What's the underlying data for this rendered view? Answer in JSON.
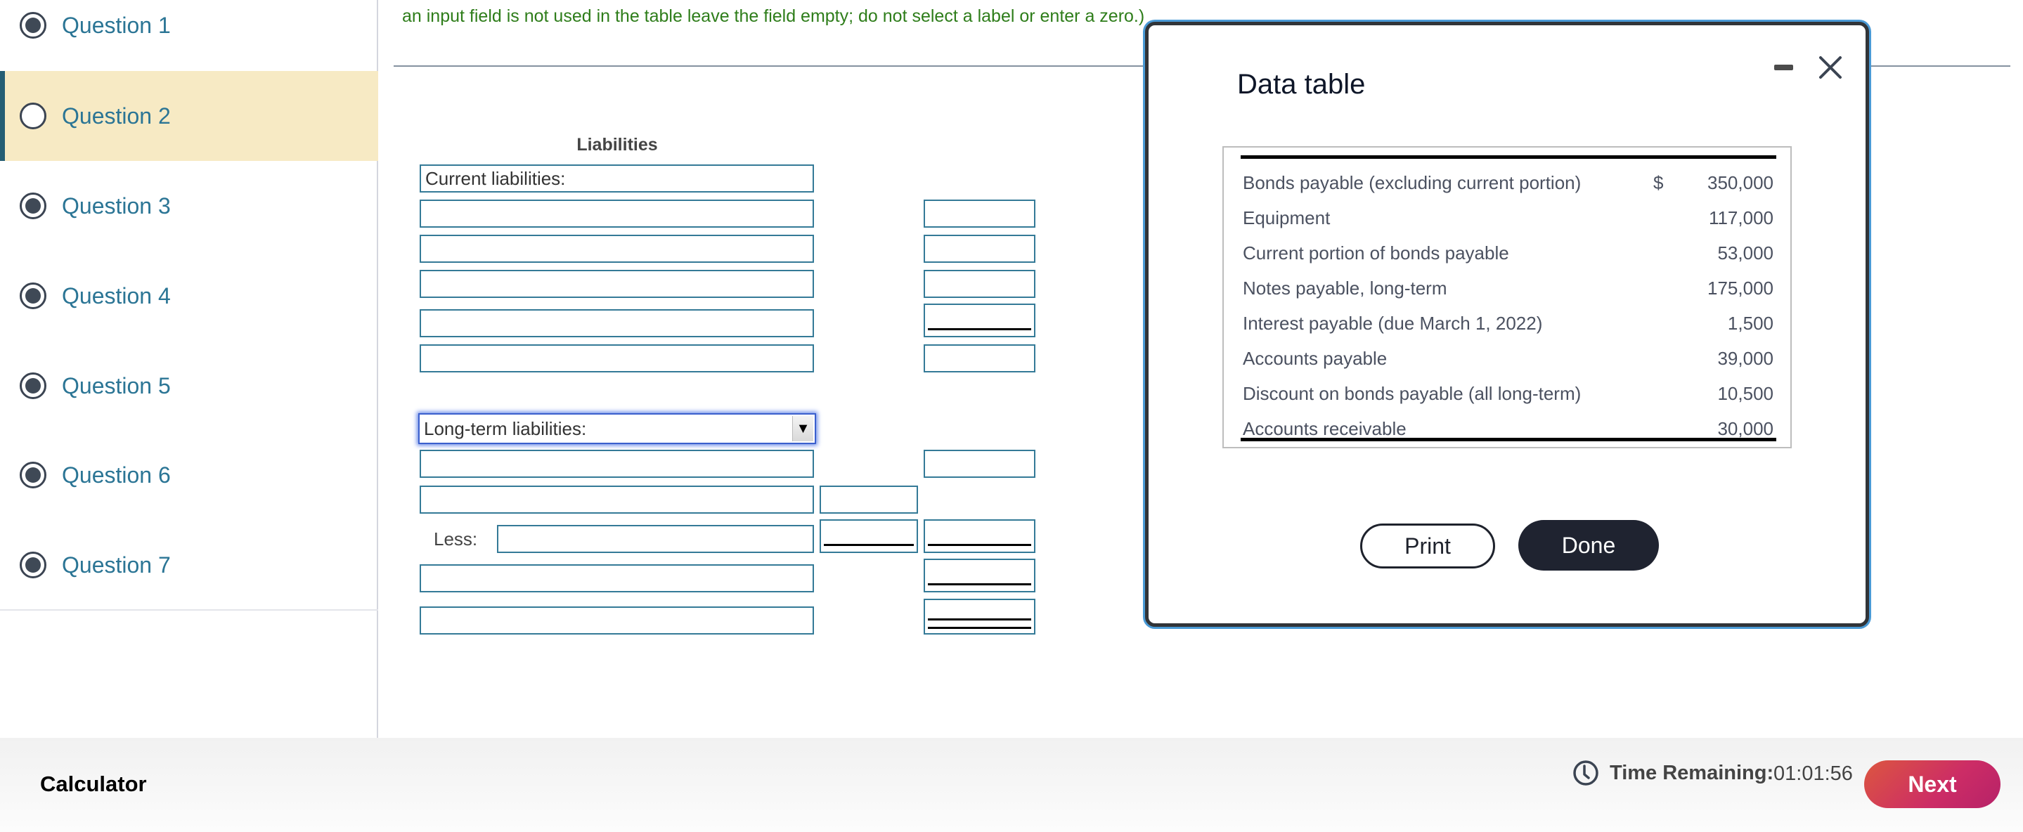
{
  "sidebar": {
    "questions": [
      {
        "label": "Question 1",
        "state": "answered"
      },
      {
        "label": "Question 2",
        "state": "current"
      },
      {
        "label": "Question 3",
        "state": "answered"
      },
      {
        "label": "Question 4",
        "state": "answered"
      },
      {
        "label": "Question 5",
        "state": "answered"
      },
      {
        "label": "Question 6",
        "state": "answered"
      },
      {
        "label": "Question 7",
        "state": "answered"
      }
    ]
  },
  "instructions": {
    "line2": "an input field is not used in the table leave the field empty; do not select a label or enter a zero.)"
  },
  "form": {
    "header": "Liabilities",
    "current_label": "Current liabilities:",
    "longterm_select_value": "Long-term liabilities:",
    "less_label": "Less:"
  },
  "modal": {
    "title": "Data table",
    "rows": [
      {
        "label": "Bonds payable (excluding current portion)",
        "currency": "$",
        "value": "350,000"
      },
      {
        "label": "Equipment",
        "currency": "",
        "value": "117,000"
      },
      {
        "label": "Current portion of bonds payable",
        "currency": "",
        "value": "53,000"
      },
      {
        "label": "Notes payable, long-term",
        "currency": "",
        "value": "175,000"
      },
      {
        "label": "Interest payable (due March 1, 2022)",
        "currency": "",
        "value": "1,500"
      },
      {
        "label": "Accounts payable",
        "currency": "",
        "value": "39,000"
      },
      {
        "label": "Discount on bonds payable (all long-term)",
        "currency": "",
        "value": "10,500"
      },
      {
        "label": "Accounts receivable",
        "currency": "",
        "value": "30,000"
      }
    ],
    "print_label": "Print",
    "done_label": "Done"
  },
  "footer": {
    "calculator_label": "Calculator",
    "time_label": "Time Remaining:",
    "time_value": "01:01:56",
    "next_label": "Next"
  },
  "colors": {
    "accent_teal": "#2b7595",
    "active_bg": "#f7eac4",
    "instruction_green": "#2e7d1a",
    "next_button": "#cc2c66"
  }
}
